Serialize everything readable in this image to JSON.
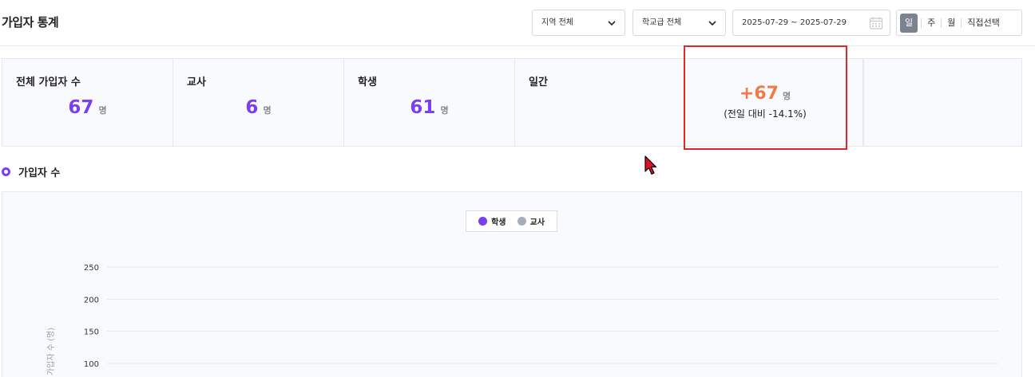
{
  "header": {
    "title": "가입자 통계",
    "region_select": "지역 전체",
    "level_select": "학교급 전체",
    "date_range": "2025-07-29 ~ 2025-07-29",
    "periods": [
      "일",
      "주",
      "월",
      "직접선택"
    ],
    "active_period": "일"
  },
  "stats": {
    "total": {
      "label": "전체 가입자 수",
      "value": "67",
      "unit": "명"
    },
    "teacher": {
      "label": "교사",
      "value": "6",
      "unit": "명"
    },
    "student": {
      "label": "학생",
      "value": "61",
      "unit": "명"
    },
    "daily": {
      "label": "일간",
      "value": "+67",
      "unit": "명",
      "compare": "(전일 대비 -14.1%)"
    }
  },
  "section": {
    "title": "가입자 수"
  },
  "colors": {
    "accent": "#7b3ff2",
    "daily_value": "#f07b4a",
    "teacher_series": "#a9adbb",
    "highlight": "#e02828"
  },
  "chart_data": {
    "type": "line",
    "series": [
      {
        "name": "학생",
        "values": []
      },
      {
        "name": "교사",
        "values": []
      }
    ],
    "ylabel": "가입자 수 (명)",
    "yticks": [
      100,
      150,
      200,
      250
    ],
    "ylim_visible": [
      100,
      250
    ],
    "legend_position": "top-center",
    "grid": true
  }
}
